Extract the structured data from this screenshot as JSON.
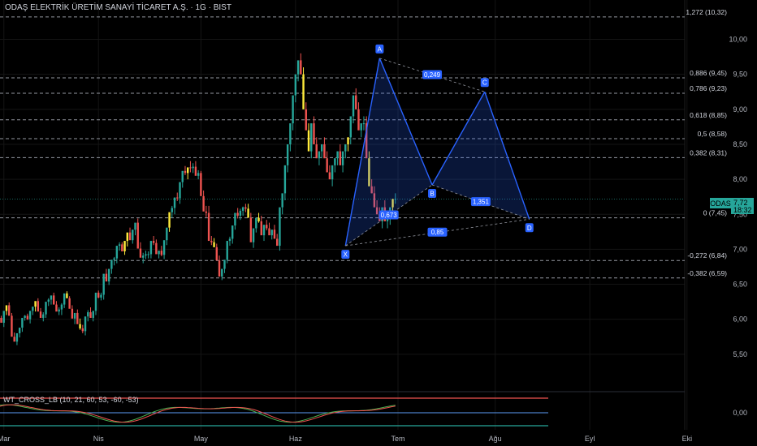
{
  "header": {
    "title": "ODAŞ ELEKTRİK ÜRETİM SANAYİ TİCARET A.Ş. · 1G · BIST"
  },
  "indicator": {
    "label": "WT_CROSS_LB (10, 21, 60, 53, -60, -53)",
    "zero_label": "0,00"
  },
  "price_tag": {
    "symbol": "ODAS",
    "price": "7,72",
    "time": "18:32"
  },
  "colors": {
    "up": "#26a69a",
    "down": "#ef5350",
    "yellow": "#ffeb3b",
    "pattern": "#2962ff",
    "bg": "#000000"
  },
  "chart_data": {
    "type": "candlestick",
    "title": "ODAŞ ELEKTRİK ÜRETİM SANAYİ TİCARET A.Ş. · 1G · BIST",
    "ylim": [
      5.0,
      10.4
    ],
    "y_ticks": [
      "5,50",
      "6,00",
      "6,50",
      "7,00",
      "7,50",
      "8,00",
      "8,50",
      "9,00",
      "9,50",
      "10,00"
    ],
    "y_tick_values": [
      5.5,
      6.0,
      6.5,
      7.0,
      7.5,
      8.0,
      8.5,
      9.0,
      9.5,
      10.0
    ],
    "x_ticks": [
      "Mar",
      "Nis",
      "May",
      "Haz",
      "Tem",
      "Ağu",
      "Eyl",
      "Eki"
    ],
    "x_tick_index": [
      10,
      46,
      85,
      121,
      160,
      197,
      233,
      270
    ],
    "fib_levels": [
      {
        "label": "1,272 (10,32)",
        "value": 10.32
      },
      {
        "label": "0,886 (9,45)",
        "value": 9.45
      },
      {
        "label": "0,786 (9,23)",
        "value": 9.23
      },
      {
        "label": "0,618 (8,85)",
        "value": 8.85
      },
      {
        "label": "0,5 (8,58)",
        "value": 8.58
      },
      {
        "label": "0,382 (8,31)",
        "value": 8.31
      },
      {
        "label": "0 (7,45)",
        "value": 7.45
      },
      {
        "label": "-0,272 (6,84)",
        "value": 6.84
      },
      {
        "label": "-0,382 (6,59)",
        "value": 6.59
      }
    ],
    "harmonic_points": [
      {
        "label": "X",
        "i": 140,
        "value": 7.05
      },
      {
        "label": "A",
        "i": 153,
        "value": 9.73
      },
      {
        "label": "B",
        "i": 173,
        "value": 7.92
      },
      {
        "label": "C",
        "i": 193,
        "value": 9.25
      },
      {
        "label": "D",
        "i": 210,
        "value": 7.43
      }
    ],
    "ratios": [
      {
        "label": "0,249",
        "from": "A",
        "to": "C"
      },
      {
        "label": "0,673",
        "from": "X",
        "to": "B"
      },
      {
        "label": "1,351",
        "from": "B",
        "to": "D"
      },
      {
        "label": "0,85",
        "from": "X",
        "to": "D"
      }
    ],
    "candles": {
      "open": [
        6.25,
        6.4,
        6.52,
        6.38,
        6.23,
        6.08,
        6.12,
        5.92,
        5.85,
        6.02,
        5.95,
        6.12,
        6.2,
        6.05,
        5.75,
        5.68,
        5.8,
        5.88,
        6.02,
        6.05,
        6.0,
        6.12,
        6.18,
        6.26,
        6.11,
        6.02,
        6.07,
        6.25,
        6.28,
        6.34,
        6.21,
        6.11,
        6.14,
        6.21,
        6.37,
        6.3,
        6.15,
        6.01,
        6.09,
        5.93,
        5.87,
        5.83,
        6.04,
        6.1,
        6.02,
        6.12,
        6.38,
        6.31,
        6.35,
        6.65,
        6.54,
        6.72,
        6.85,
        6.87,
        7.05,
        7.07,
        6.97,
        7.12,
        7.24,
        7.13,
        7.28,
        7.38,
        7.01,
        6.88,
        6.91,
        6.93,
        6.93,
        7.12,
        7.09,
        6.93,
        6.98,
        6.92,
        7.13,
        7.31,
        7.53,
        7.59,
        7.74,
        7.73,
        7.96,
        8.12,
        8.09,
        8.17,
        8.16,
        8.18,
        8.05,
        8.09,
        7.76,
        7.54,
        7.52,
        7.12,
        7.1,
        7.03,
        6.84,
        6.61,
        6.72,
        6.85,
        7.12,
        7.15,
        7.34,
        7.52,
        7.48,
        7.55,
        7.6,
        7.58,
        7.45,
        7.1,
        7.3,
        7.45,
        7.4,
        7.2,
        7.35,
        7.3,
        7.2,
        7.28,
        7.15,
        7.05,
        7.6,
        7.8,
        8.2,
        8.5,
        8.8,
        9.2,
        9.5,
        9.7,
        9.5,
        9.0,
        8.7,
        8.4,
        8.8,
        8.5,
        8.3,
        8.4,
        8.5,
        8.3,
        8.1,
        8.0,
        8.2,
        8.3,
        8.4,
        8.2,
        8.4,
        8.5,
        8.6,
        8.9,
        9.2,
        9.0,
        8.7,
        8.8,
        8.8,
        8.3,
        7.9,
        7.8,
        7.6,
        7.5,
        7.4,
        7.6,
        7.4,
        7.45,
        7.6,
        7.72
      ],
      "high": [
        6.32,
        6.45,
        6.56,
        6.44,
        6.29,
        6.15,
        6.18,
        6.0,
        5.91,
        6.05,
        6.03,
        6.16,
        6.24,
        6.09,
        5.81,
        5.74,
        5.85,
        5.96,
        6.06,
        6.08,
        6.07,
        6.17,
        6.25,
        6.3,
        6.16,
        6.1,
        6.14,
        6.3,
        6.32,
        6.38,
        6.26,
        6.17,
        6.23,
        6.29,
        6.4,
        6.33,
        6.2,
        6.07,
        6.14,
        6.01,
        5.92,
        5.89,
        6.13,
        6.17,
        6.09,
        6.18,
        6.41,
        6.38,
        6.39,
        6.72,
        6.62,
        6.79,
        6.89,
        6.91,
        7.1,
        7.1,
        7.02,
        7.16,
        7.31,
        7.19,
        7.35,
        7.44,
        7.1,
        6.95,
        6.98,
        6.97,
        6.97,
        7.19,
        7.14,
        6.98,
        7.05,
        7.0,
        7.18,
        7.4,
        7.62,
        7.66,
        7.81,
        7.82,
        8.02,
        8.19,
        8.14,
        8.26,
        8.23,
        8.26,
        8.13,
        8.12,
        7.84,
        7.62,
        7.62,
        7.19,
        7.16,
        7.08,
        6.91,
        6.68,
        6.79,
        6.92,
        7.18,
        7.21,
        7.41,
        7.59,
        7.58,
        7.61,
        7.65,
        7.65,
        7.52,
        7.2,
        7.38,
        7.52,
        7.48,
        7.28,
        7.42,
        7.38,
        7.28,
        7.35,
        7.22,
        7.12,
        7.7,
        7.9,
        8.3,
        8.6,
        8.9,
        9.3,
        9.6,
        9.8,
        9.6,
        9.1,
        8.8,
        8.5,
        8.9,
        8.6,
        8.4,
        8.5,
        8.6,
        8.4,
        8.2,
        8.1,
        8.3,
        8.4,
        8.5,
        8.3,
        8.5,
        8.6,
        8.7,
        9.0,
        9.3,
        9.1,
        8.8,
        8.9,
        8.9,
        8.4,
        8.0,
        7.9,
        7.7,
        7.6,
        7.5,
        7.7,
        7.5,
        7.55,
        7.7,
        7.8
      ],
      "low": [
        6.17,
        6.33,
        6.43,
        6.29,
        6.16,
        5.99,
        6.04,
        5.84,
        5.8,
        5.96,
        5.89,
        6.06,
        6.15,
        5.96,
        5.69,
        5.63,
        5.74,
        5.82,
        5.98,
        5.99,
        5.94,
        6.06,
        6.11,
        6.19,
        6.05,
        5.97,
        6.02,
        6.19,
        6.21,
        6.27,
        6.14,
        6.06,
        6.06,
        6.16,
        6.32,
        6.23,
        6.09,
        5.93,
        6.02,
        5.85,
        5.8,
        5.77,
        5.97,
        6.04,
        5.97,
        6.06,
        6.3,
        6.27,
        6.28,
        6.6,
        6.49,
        6.65,
        6.77,
        6.8,
        6.98,
        7.03,
        6.92,
        7.04,
        7.17,
        7.08,
        7.2,
        7.29,
        6.94,
        6.8,
        6.86,
        6.87,
        6.87,
        7.06,
        7.04,
        6.87,
        6.9,
        6.86,
        7.06,
        7.25,
        7.45,
        7.5,
        7.69,
        7.65,
        7.88,
        8.06,
        8.0,
        8.1,
        8.09,
        8.1,
        8.0,
        8.02,
        7.7,
        7.46,
        7.44,
        7.06,
        7.03,
        6.98,
        6.79,
        6.56,
        6.66,
        6.8,
        7.05,
        7.08,
        7.28,
        7.44,
        7.42,
        7.48,
        7.53,
        7.52,
        7.39,
        7.02,
        7.24,
        7.38,
        7.34,
        7.12,
        7.27,
        7.24,
        7.14,
        7.22,
        7.08,
        6.98,
        7.5,
        7.7,
        8.1,
        8.4,
        8.7,
        9.1,
        9.4,
        9.6,
        9.4,
        8.9,
        8.6,
        8.3,
        8.7,
        8.4,
        8.2,
        8.3,
        8.4,
        8.2,
        8.0,
        7.9,
        8.1,
        8.2,
        8.3,
        8.1,
        8.3,
        8.4,
        8.5,
        8.8,
        9.1,
        8.9,
        8.6,
        8.7,
        8.7,
        8.2,
        7.8,
        7.7,
        7.5,
        7.4,
        7.3,
        7.5,
        7.3,
        7.35,
        7.5,
        7.65
      ],
      "close": [
        6.4,
        6.52,
        6.38,
        6.23,
        6.08,
        6.12,
        5.92,
        5.85,
        6.02,
        5.95,
        6.12,
        6.2,
        6.05,
        5.75,
        5.68,
        5.8,
        5.88,
        6.02,
        6.05,
        6.0,
        6.12,
        6.18,
        6.26,
        6.11,
        6.02,
        6.07,
        6.25,
        6.28,
        6.34,
        6.21,
        6.11,
        6.14,
        6.21,
        6.37,
        6.3,
        6.15,
        6.01,
        6.09,
        5.93,
        5.87,
        5.83,
        6.04,
        6.1,
        6.02,
        6.12,
        6.38,
        6.31,
        6.35,
        6.65,
        6.54,
        6.72,
        6.85,
        6.87,
        7.05,
        7.07,
        6.97,
        7.12,
        7.24,
        7.13,
        7.28,
        7.38,
        7.01,
        6.88,
        6.91,
        6.93,
        6.93,
        7.12,
        7.09,
        6.93,
        6.98,
        6.92,
        7.13,
        7.31,
        7.53,
        7.59,
        7.74,
        7.73,
        7.96,
        8.12,
        8.09,
        8.17,
        8.16,
        8.18,
        8.05,
        8.09,
        7.76,
        7.54,
        7.52,
        7.12,
        7.1,
        7.03,
        6.84,
        6.61,
        6.72,
        6.85,
        7.12,
        7.15,
        7.34,
        7.52,
        7.48,
        7.55,
        7.6,
        7.58,
        7.45,
        7.1,
        7.3,
        7.45,
        7.4,
        7.2,
        7.35,
        7.3,
        7.2,
        7.28,
        7.15,
        7.05,
        7.6,
        7.8,
        8.2,
        8.5,
        8.8,
        9.2,
        9.5,
        9.7,
        9.5,
        9.0,
        8.7,
        8.4,
        8.8,
        8.5,
        8.3,
        8.4,
        8.5,
        8.3,
        8.1,
        8.0,
        8.2,
        8.3,
        8.4,
        8.2,
        8.4,
        8.5,
        8.6,
        8.9,
        9.2,
        9.0,
        8.7,
        8.8,
        8.8,
        8.3,
        7.9,
        7.8,
        7.6,
        7.5,
        7.4,
        7.6,
        7.4,
        7.45,
        7.6,
        7.72,
        7.72
      ]
    }
  }
}
